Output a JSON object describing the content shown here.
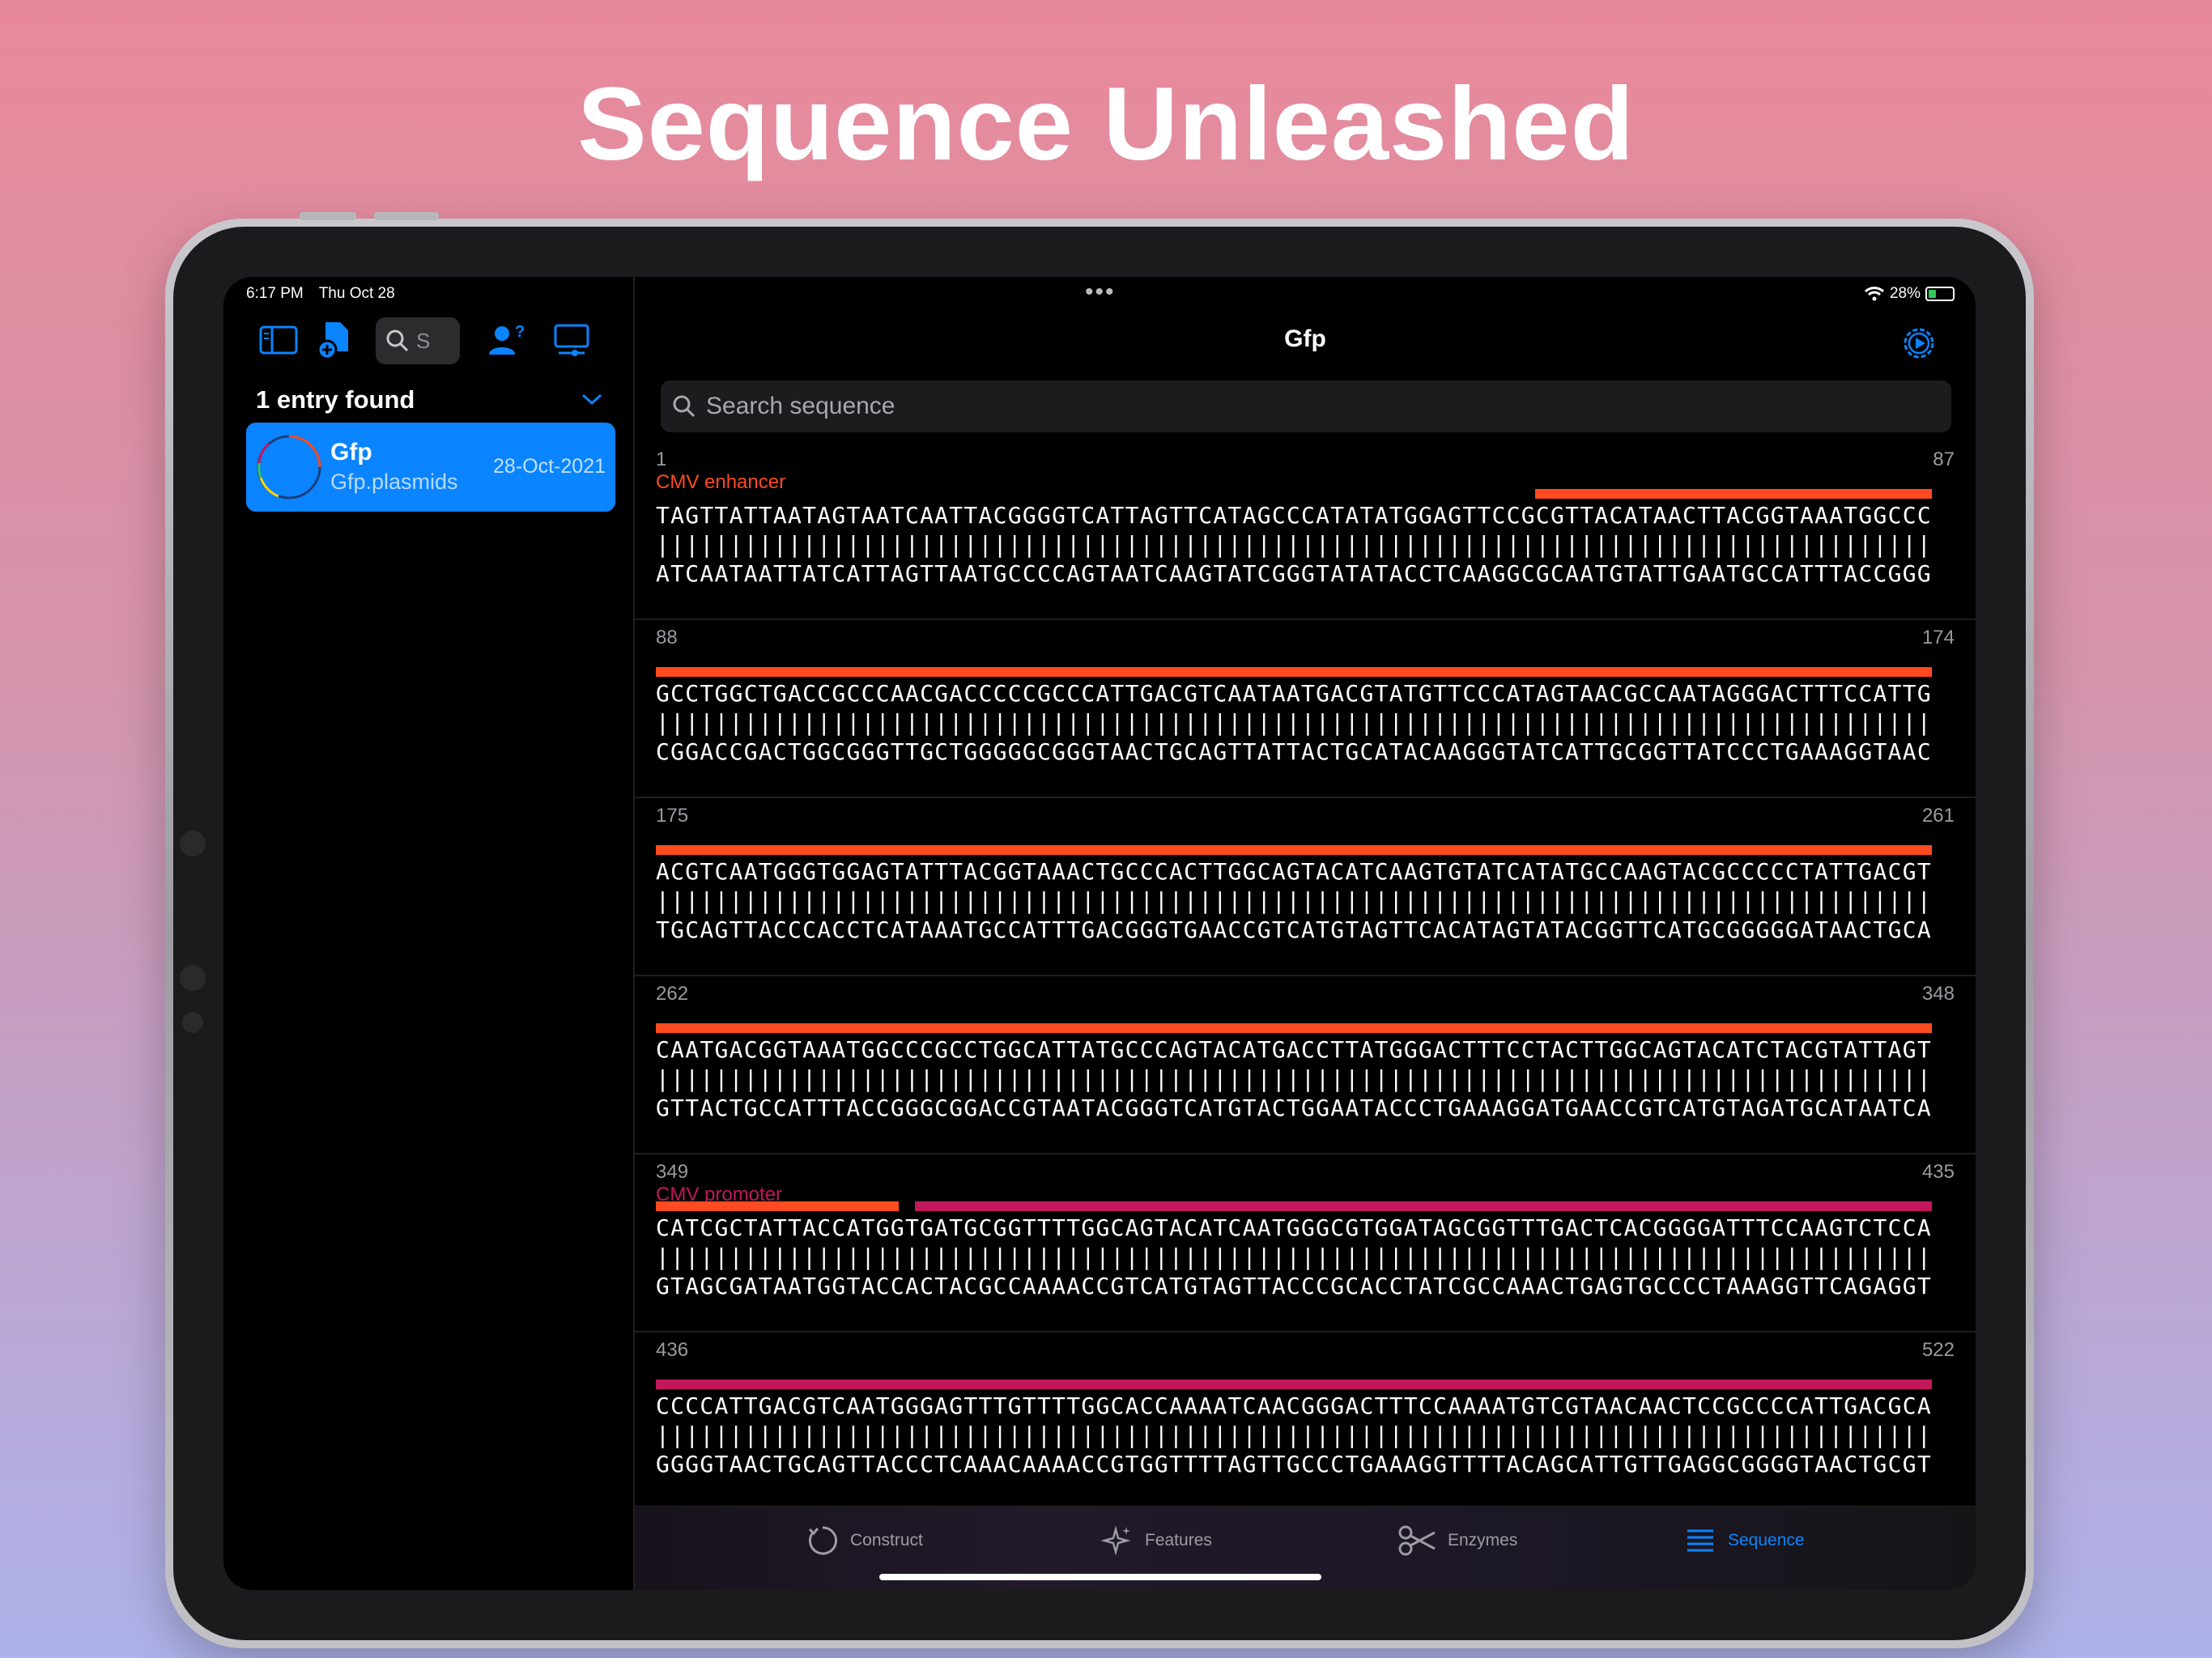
{
  "headline": "Sequence Unleashed",
  "status": {
    "time": "6:17 PM",
    "date": "Thu Oct 28",
    "battery": "28%"
  },
  "sidebar": {
    "search_placeholder": "S",
    "entries_found": "1 entry found",
    "entry": {
      "name": "Gfp",
      "subtitle": "Gfp.plasmids",
      "date": "28-Oct-2021"
    }
  },
  "main": {
    "title": "Gfp",
    "search_placeholder": "Search sequence"
  },
  "sequence_blocks": [
    {
      "start": "1",
      "end": "87",
      "label": "CMV enhancer",
      "top": "TAGTTATTAATAGTAATCAATTACGGGGTCATTAGTTCATAGCCCATATATGGAGTTCCGCGTTACATAACTTACGGTAAATGGCCC",
      "bottom": "ATCAATAATTATCATTAGTTAATGCCCCAGTAATCAAGTATCGGGTATATACCTCAAGGCGCAATGTATTGAATGCCATTTACCGGG"
    },
    {
      "start": "88",
      "end": "174",
      "label": "",
      "top": "GCCTGGCTGACCGCCCAACGACCCCCGCCCATTGACGTCAATAATGACGTATGTTCCCATAGTAACGCCAATAGGGACTTTCCATTG",
      "bottom": "CGGACCGACTGGCGGGTTGCTGGGGGCGGGTAACTGCAGTTATTACTGCATACAAGGGTATCATTGCGGTTATCCCTGAAAGGTAAC"
    },
    {
      "start": "175",
      "end": "261",
      "label": "",
      "top": "ACGTCAATGGGTGGAGTATTTACGGTAAACTGCCCACTTGGCAGTACATCAAGTGTATCATATGCCAAGTACGCCCCCTATTGACGT",
      "bottom": "TGCAGTTACCCACCTCATAAATGCCATTTGACGGGTGAACCGTCATGTAGTTCACATAGTATACGGTTCATGCGGGGGATAACTGCA"
    },
    {
      "start": "262",
      "end": "348",
      "label": "",
      "top": "CAATGACGGTAAATGGCCCGCCTGGCATTATGCCCAGTACATGACCTTATGGGACTTTCCTACTTGGCAGTACATCTACGTATTAGT",
      "bottom": "GTTACTGCCATTTACCGGGCGGACCGTAATACGGGTCATGTACTGGAATACCCTGAAAGGATGAACCGTCATGTAGATGCATAATCA"
    },
    {
      "start": "349",
      "end": "435",
      "label": "CMV promoter",
      "top": "CATCGCTATTACCATGGTGATGCGGTTTTGGCAGTACATCAATGGGCGTGGATAGCGGTTTGACTCACGGGGATTTCCAAGTCTCCA",
      "bottom": "GTAGCGATAATGGTACCACTACGCCAAAACCGTCATGTAGTTACCCGCACCTATCGCCAAACTGAGTGCCCCTAAAGGTTCAGAGGT"
    },
    {
      "start": "436",
      "end": "522",
      "label": "",
      "top": "CCCCATTGACGTCAATGGGAGTTTGTTTTGGCACCAAAATCAACGGGACTTTCCAAAATGTCGTAACAACTCCGCCCCATTGACGCA",
      "bottom": "GGGGTAACTGCAGTTACCCTCAAACAAAACCGTGGTTTTAGTTGCCCTGAAAGGTTTTACAGCATTGTTGAGGCGGGGTAACTGCGT"
    }
  ],
  "tabs": [
    {
      "label": "Construct",
      "icon": "construct-icon"
    },
    {
      "label": "Features",
      "icon": "sparkle-icon"
    },
    {
      "label": "Enzymes",
      "icon": "scissors-icon"
    },
    {
      "label": "Sequence",
      "icon": "list-icon",
      "active": true
    }
  ],
  "colors": {
    "accent": "#0a84ff",
    "enhancer": "#ff4b1f",
    "promoter": "#c2185b"
  }
}
